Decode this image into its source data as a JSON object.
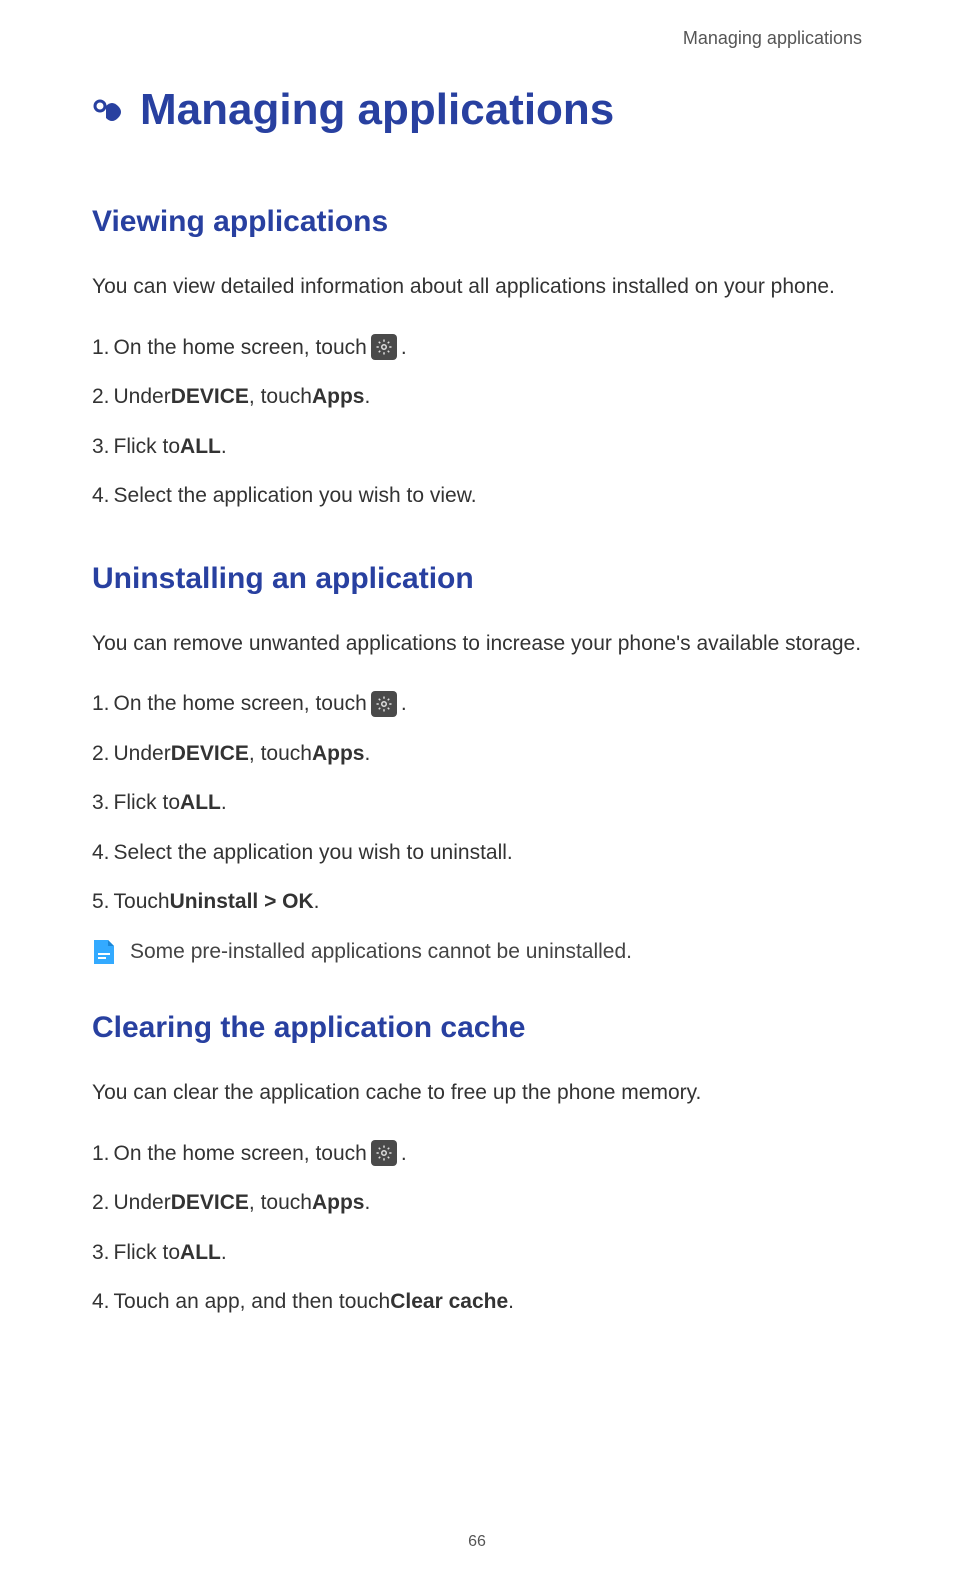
{
  "header": {
    "breadcrumb": "Managing applications"
  },
  "chapter": {
    "title": "Managing applications"
  },
  "sections": {
    "viewing": {
      "heading": "Viewing applications",
      "intro": "You can view detailed information about all applications installed on your phone.",
      "steps": {
        "s1_num": "1.",
        "s1_pre": "On the home screen, touch ",
        "s1_post": " .",
        "s2_num": "2.",
        "s2_a": "Under ",
        "s2_b": "DEVICE",
        "s2_c": ", touch ",
        "s2_d": "Apps",
        "s2_e": ".",
        "s3_num": "3.",
        "s3_a": "Flick to ",
        "s3_b": "ALL",
        "s3_c": ".",
        "s4_num": "4.",
        "s4_a": "Select the application you wish to view."
      }
    },
    "uninstall": {
      "heading": "Uninstalling an application",
      "intro": "You can remove unwanted applications to increase your phone's available storage.",
      "steps": {
        "s1_num": "1.",
        "s1_pre": "On the home screen, touch ",
        "s1_post": " .",
        "s2_num": "2.",
        "s2_a": "Under ",
        "s2_b": "DEVICE",
        "s2_c": ", touch ",
        "s2_d": "Apps",
        "s2_e": ".",
        "s3_num": "3.",
        "s3_a": "Flick to ",
        "s3_b": "ALL",
        "s3_c": ".",
        "s4_num": "4.",
        "s4_a": "Select the application you wish to uninstall.",
        "s5_num": "5.",
        "s5_a": "Touch ",
        "s5_b": "Uninstall > OK",
        "s5_c": "."
      },
      "note": "Some pre-installed applications cannot be uninstalled."
    },
    "cache": {
      "heading": "Clearing the application cache",
      "intro": "You can clear the application cache to free up the phone memory.",
      "steps": {
        "s1_num": "1.",
        "s1_pre": "On the home screen, touch ",
        "s1_post": " .",
        "s2_num": "2.",
        "s2_a": "Under ",
        "s2_b": "DEVICE",
        "s2_c": ", touch ",
        "s2_d": "Apps",
        "s2_e": ".",
        "s3_num": "3.",
        "s3_a": "Flick to ",
        "s3_b": "ALL",
        "s3_c": ".",
        "s4_num": "4.",
        "s4_a": "Touch an app, and then touch ",
        "s4_b": "Clear cache",
        "s4_c": "."
      }
    }
  },
  "page_number": "66"
}
